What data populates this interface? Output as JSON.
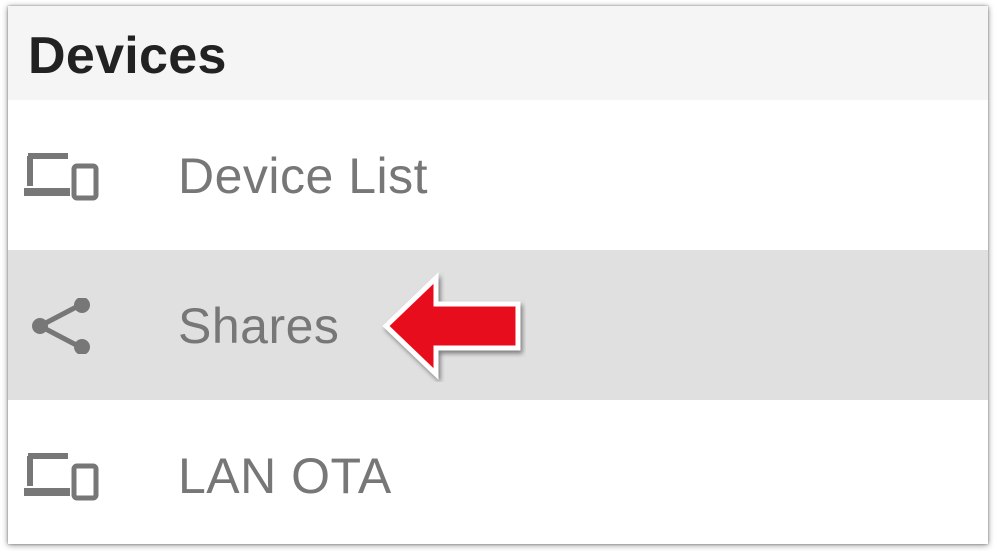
{
  "section": {
    "title": "Devices"
  },
  "menu": {
    "items": [
      {
        "label": "Device List",
        "icon": "devices-icon",
        "selected": false
      },
      {
        "label": "Shares",
        "icon": "share-icon",
        "selected": true
      },
      {
        "label": "LAN OTA",
        "icon": "devices-icon",
        "selected": false
      }
    ]
  },
  "annotation": {
    "arrow_color": "#e8101c",
    "arrow_icon": "red-left-arrow"
  },
  "colors": {
    "header_background": "#f5f5f5",
    "selected_background": "#e0e0e0",
    "label_text": "#777777",
    "title_text": "#222222"
  }
}
